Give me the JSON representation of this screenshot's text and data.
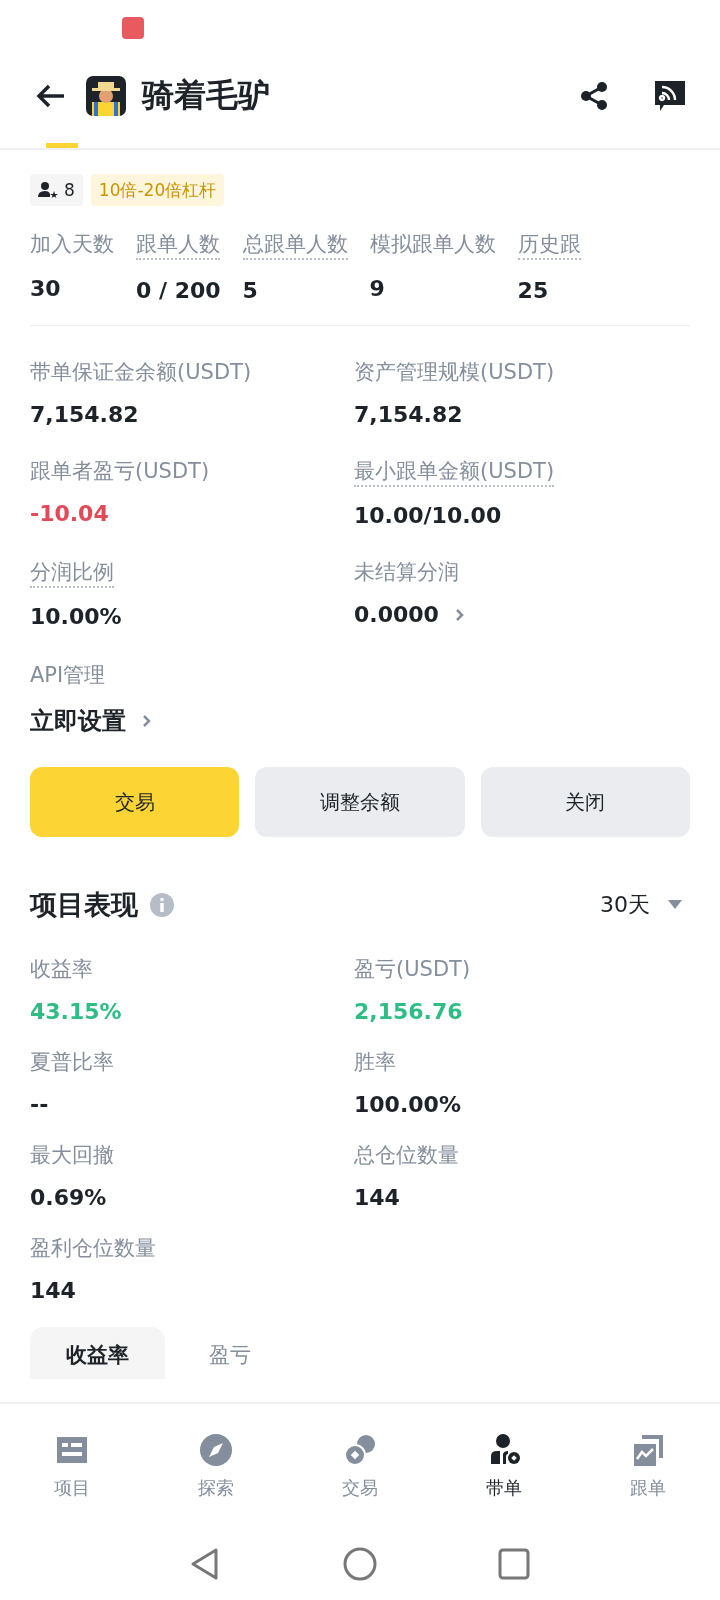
{
  "header": {
    "title": "骑着毛驴"
  },
  "badges": [
    {
      "kind": "followers",
      "text": "8"
    },
    {
      "kind": "leverage",
      "text": "10倍-20倍杠杆"
    }
  ],
  "stats": [
    {
      "label": "加入天数",
      "value": "30",
      "hint": false
    },
    {
      "label": "跟单人数",
      "value": "0 / 200",
      "hint": true
    },
    {
      "label": "总跟单人数",
      "value": "5",
      "hint": true
    },
    {
      "label": "模拟跟单人数",
      "value": "9",
      "hint": false
    },
    {
      "label": "历史跟",
      "value": "25",
      "hint": true
    }
  ],
  "account": [
    {
      "label": "带单保证金余额(USDT)",
      "value": "7,154.82",
      "hint": false,
      "color": "#1e2329",
      "link": false
    },
    {
      "label": "资产管理规模(USDT)",
      "value": "7,154.82",
      "hint": false,
      "color": "#1e2329",
      "link": false
    },
    {
      "label": "跟单者盈亏(USDT)",
      "value": "-10.04",
      "hint": false,
      "color": "#e04a59",
      "link": false
    },
    {
      "label": "最小跟单金额(USDT)",
      "value": "10.00/10.00",
      "hint": true,
      "color": "#1e2329",
      "link": false
    },
    {
      "label": "分润比例",
      "value": "10.00%",
      "hint": true,
      "color": "#1e2329",
      "link": false
    },
    {
      "label": "未结算分润",
      "value": "0.0000",
      "hint": false,
      "color": "#1e2329",
      "link": true
    }
  ],
  "api": {
    "label": "API管理",
    "action": "立即设置"
  },
  "buttons": [
    {
      "label": "交易",
      "primary": true
    },
    {
      "label": "调整余额",
      "primary": false
    },
    {
      "label": "关闭",
      "primary": false
    }
  ],
  "performance": {
    "title": "项目表现",
    "period": "30天",
    "metrics": [
      {
        "label": "收益率",
        "value": "43.15%",
        "color": "#2ebd85"
      },
      {
        "label": "盈亏(USDT)",
        "value": "2,156.76",
        "color": "#2ebd85"
      },
      {
        "label": "夏普比率",
        "value": "--",
        "color": "#1e2329"
      },
      {
        "label": "胜率",
        "value": "100.00%",
        "color": "#1e2329"
      },
      {
        "label": "最大回撤",
        "value": "0.69%",
        "color": "#1e2329"
      },
      {
        "label": "总仓位数量",
        "value": "144",
        "color": "#1e2329"
      },
      {
        "label": "盈利仓位数量",
        "value": "144",
        "color": "#1e2329"
      }
    ],
    "tabs": [
      {
        "label": "收益率",
        "selected": true
      },
      {
        "label": "盈亏",
        "selected": false
      }
    ]
  },
  "nav": [
    {
      "kind": "projects",
      "label": "项目",
      "selected": false
    },
    {
      "kind": "explore",
      "label": "探索",
      "selected": false
    },
    {
      "kind": "trade",
      "label": "交易",
      "selected": false
    },
    {
      "kind": "lead",
      "label": "带单",
      "selected": true
    },
    {
      "kind": "copy",
      "label": "跟单",
      "selected": false
    }
  ]
}
